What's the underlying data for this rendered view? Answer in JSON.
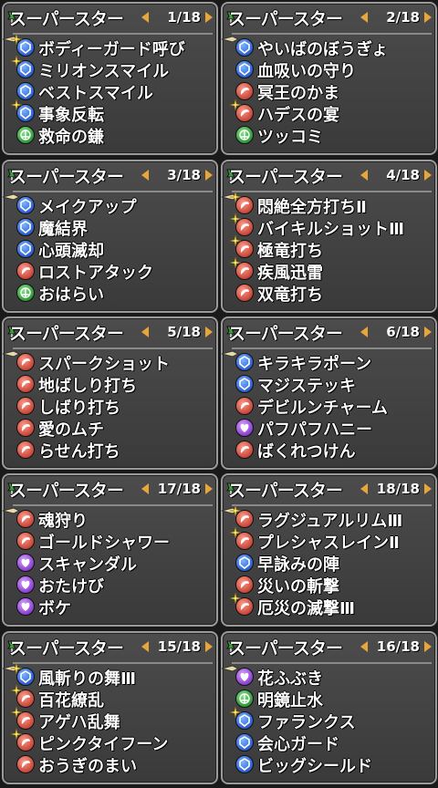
{
  "colors": {
    "accent_orange": "#e8a53a",
    "panel_bg": "#444444",
    "text": "#ffffff"
  },
  "panels": [
    {
      "title": "スーパースター",
      "page": "1/18",
      "items": [
        {
          "label": "ボディーガード呼び",
          "icon": "blue",
          "spark": true
        },
        {
          "label": "ミリオンスマイル",
          "icon": "blue",
          "spark": true
        },
        {
          "label": "ベストスマイル",
          "icon": "blue",
          "spark": false
        },
        {
          "label": "事象反転",
          "icon": "blue",
          "spark": true
        },
        {
          "label": "救命の鎌",
          "icon": "green",
          "spark": false
        }
      ]
    },
    {
      "title": "スーパースター",
      "page": "2/18",
      "items": [
        {
          "label": "やいばのぼうぎょ",
          "icon": "blue",
          "spark": false
        },
        {
          "label": "血吸いの守り",
          "icon": "blue",
          "spark": false
        },
        {
          "label": "冥王のかま",
          "icon": "red",
          "spark": false
        },
        {
          "label": "ハデスの宴",
          "icon": "red",
          "spark": true
        },
        {
          "label": "ツッコミ",
          "icon": "green",
          "spark": false
        }
      ]
    },
    {
      "title": "スーパースター",
      "page": "3/18",
      "items": [
        {
          "label": "メイクアップ",
          "icon": "blue",
          "spark": false
        },
        {
          "label": "魔結界",
          "icon": "blue",
          "spark": false
        },
        {
          "label": "心頭滅却",
          "icon": "blue",
          "spark": false
        },
        {
          "label": "ロストアタック",
          "icon": "red",
          "spark": false
        },
        {
          "label": "おはらい",
          "icon": "green",
          "spark": false
        }
      ]
    },
    {
      "title": "スーパースター",
      "page": "4/18",
      "items": [
        {
          "label": "悶絶全方打ちⅡ",
          "icon": "red",
          "spark": true
        },
        {
          "label": "バイキルショットⅢ",
          "icon": "red",
          "spark": true
        },
        {
          "label": "極竜打ち",
          "icon": "red",
          "spark": true
        },
        {
          "label": "疾風迅雷",
          "icon": "red",
          "spark": true
        },
        {
          "label": "双竜打ち",
          "icon": "red",
          "spark": false
        }
      ]
    },
    {
      "title": "スーパースター",
      "page": "5/18",
      "items": [
        {
          "label": "スパークショット",
          "icon": "red",
          "spark": false
        },
        {
          "label": "地ばしり打ち",
          "icon": "red",
          "spark": false
        },
        {
          "label": "しばり打ち",
          "icon": "red",
          "spark": false
        },
        {
          "label": "愛のムチ",
          "icon": "red",
          "spark": false
        },
        {
          "label": "らせん打ち",
          "icon": "red",
          "spark": false
        }
      ]
    },
    {
      "title": "スーパースター",
      "page": "6/18",
      "items": [
        {
          "label": "キラキラポーン",
          "icon": "blue",
          "spark": false
        },
        {
          "label": "マジステッキ",
          "icon": "blue",
          "spark": false
        },
        {
          "label": "デビルンチャーム",
          "icon": "red",
          "spark": false
        },
        {
          "label": "パフパフハニー",
          "icon": "purple",
          "spark": false
        },
        {
          "label": "ばくれつけん",
          "icon": "red",
          "spark": false
        }
      ]
    },
    {
      "title": "スーパースター",
      "page": "17/18",
      "items": [
        {
          "label": "魂狩り",
          "icon": "red",
          "spark": false
        },
        {
          "label": "ゴールドシャワー",
          "icon": "red",
          "spark": false
        },
        {
          "label": "スキャンダル",
          "icon": "purple",
          "spark": false
        },
        {
          "label": "おたけび",
          "icon": "purple",
          "spark": false
        },
        {
          "label": "ボケ",
          "icon": "purple",
          "spark": false
        }
      ]
    },
    {
      "title": "スーパースター",
      "page": "18/18",
      "items": [
        {
          "label": "ラグジュアルリムⅢ",
          "icon": "red",
          "spark": true
        },
        {
          "label": "プレシャスレインⅡ",
          "icon": "red",
          "spark": true
        },
        {
          "label": "早詠みの陣",
          "icon": "blue",
          "spark": false
        },
        {
          "label": "災いの斬撃",
          "icon": "red",
          "spark": false
        },
        {
          "label": "厄災の滅撃Ⅲ",
          "icon": "red",
          "spark": true
        }
      ]
    },
    {
      "title": "スーパースター",
      "page": "15/18",
      "items": [
        {
          "label": "風斬りの舞Ⅲ",
          "icon": "blue",
          "spark": true
        },
        {
          "label": "百花繚乱",
          "icon": "red",
          "spark": true
        },
        {
          "label": "アゲハ乱舞",
          "icon": "red",
          "spark": true
        },
        {
          "label": "ピンクタイフーン",
          "icon": "red",
          "spark": true
        },
        {
          "label": "おうぎのまい",
          "icon": "red",
          "spark": false
        }
      ]
    },
    {
      "title": "スーパースター",
      "page": "16/18",
      "items": [
        {
          "label": "花ふぶき",
          "icon": "purple",
          "spark": false
        },
        {
          "label": "明鏡止水",
          "icon": "green",
          "spark": false
        },
        {
          "label": "ファランクス",
          "icon": "blue",
          "spark": true
        },
        {
          "label": "会心ガード",
          "icon": "blue",
          "spark": false
        },
        {
          "label": "ビッグシールド",
          "icon": "blue",
          "spark": false
        }
      ]
    }
  ]
}
